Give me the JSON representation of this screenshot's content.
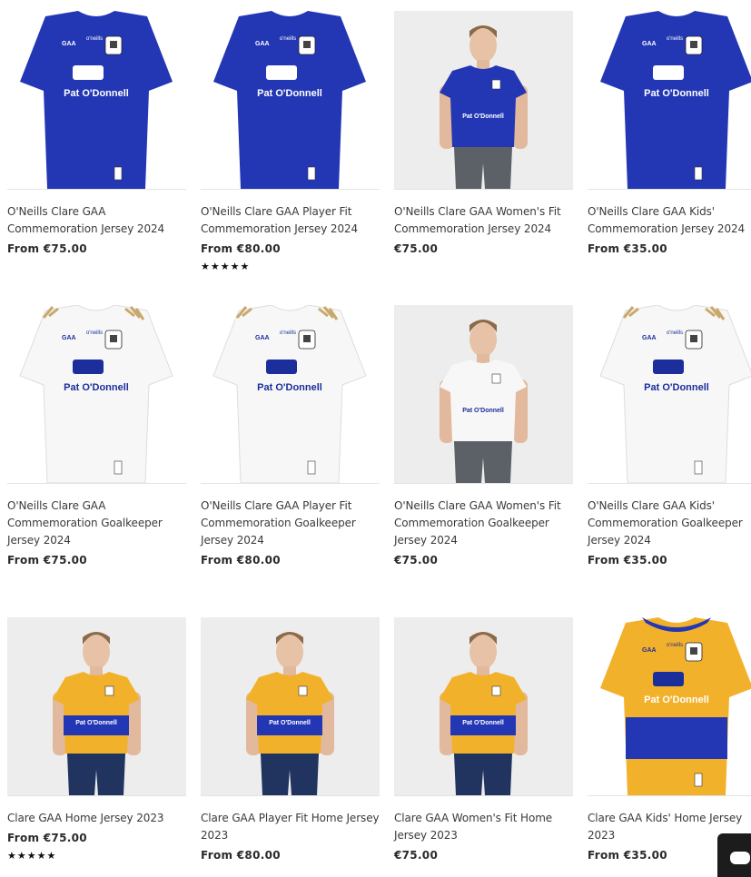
{
  "colors": {
    "blue": "#2337b5",
    "white_kit": "#f7f7f7",
    "saffron": "#f2b12a",
    "studio_bg": "#ededed",
    "text": "#3a3a3a"
  },
  "products": [
    {
      "title": "O'Neills Clare GAA Commemoration Jersey 2024",
      "price": "From €75.00",
      "rating": 0,
      "kit": "blue",
      "photo": "flat"
    },
    {
      "title": "O'Neills Clare GAA Player Fit Commemoration Jersey 2024",
      "price": "From €80.00",
      "rating": 5,
      "kit": "blue",
      "photo": "flat"
    },
    {
      "title": "O'Neills Clare GAA Women's Fit Commemoration Jersey 2024",
      "price": "€75.00",
      "rating": 0,
      "kit": "blue",
      "photo": "model"
    },
    {
      "title": "O'Neills Clare GAA Kids' Commemoration Jersey 2024",
      "price": "From €35.00",
      "rating": 0,
      "kit": "blue",
      "photo": "flat"
    },
    {
      "title": "O'Neills Clare GAA Commemoration Goalkeeper Jersey 2024",
      "price": "From €75.00",
      "rating": 0,
      "kit": "white",
      "photo": "flat"
    },
    {
      "title": "O'Neills Clare GAA Player Fit Commemoration Goalkeeper Jersey 2024",
      "price": "From €80.00",
      "rating": 0,
      "kit": "white",
      "photo": "flat"
    },
    {
      "title": "O'Neills Clare GAA Women's Fit Commemoration Goalkeeper Jersey 2024",
      "price": "€75.00",
      "rating": 0,
      "kit": "white",
      "photo": "model"
    },
    {
      "title": "O'Neills Clare GAA Kids' Commemoration Goalkeeper Jersey 2024",
      "price": "From €35.00",
      "rating": 0,
      "kit": "white",
      "photo": "flat"
    },
    {
      "title": "Clare GAA Home Jersey 2023",
      "price": "From €75.00",
      "rating": 5,
      "kit": "saffron",
      "photo": "model"
    },
    {
      "title": "Clare GAA Player Fit Home Jersey 2023",
      "price": "From €80.00",
      "rating": 0,
      "kit": "saffron",
      "photo": "model"
    },
    {
      "title": "Clare GAA Women's Fit Home Jersey 2023",
      "price": "€75.00",
      "rating": 0,
      "kit": "saffron",
      "photo": "model"
    },
    {
      "title": "Clare GAA Kids' Home Jersey 2023",
      "price": "From €35.00",
      "rating": 0,
      "kit": "saffron",
      "photo": "flat"
    }
  ],
  "sponsor_text": "Pat O'Donnell",
  "brand_text": "o'neills",
  "chat": {
    "icon": "chat-bubble-icon"
  }
}
